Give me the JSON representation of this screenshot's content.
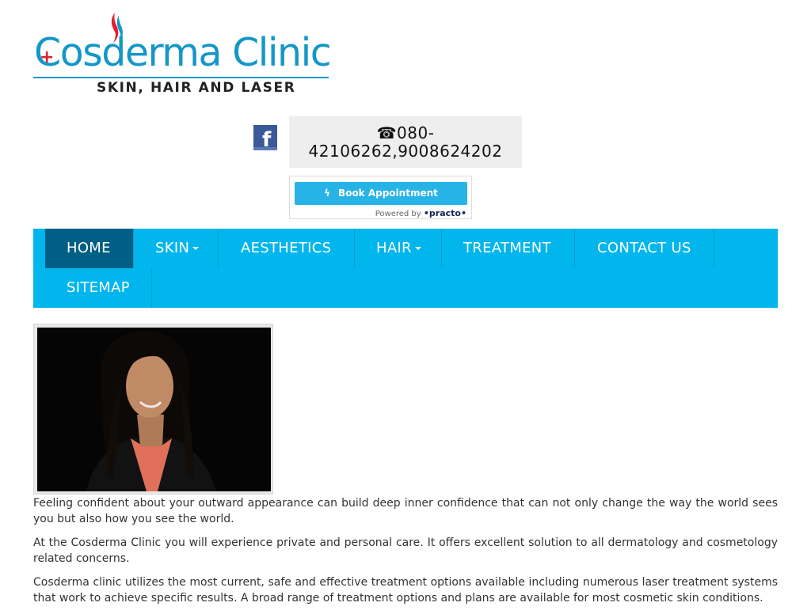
{
  "logo": {
    "title": "Cosderma Clinic",
    "cross": "+",
    "tagline": "SKIN, HAIR AND LASER",
    "brand_color": "#1497c8",
    "cross_color": "#e02030"
  },
  "social": {
    "facebook_glyph": "f",
    "icon": "facebook-icon",
    "color": "#3b5998"
  },
  "contact": {
    "phone_glyph": "☎",
    "phone_text": "080-42106262,9008624202"
  },
  "booking": {
    "button_label": "Book Appointment",
    "bolt_glyph": "ϟ",
    "powered_by": "Powered by",
    "brand": "•practo•",
    "color": "#28b3e6"
  },
  "nav": {
    "color": "#00b6ed",
    "active_color": "#005f85",
    "items": [
      {
        "label": "HOME",
        "active": true,
        "dropdown": false
      },
      {
        "label": "SKIN",
        "active": false,
        "dropdown": true
      },
      {
        "label": "AESTHETICS",
        "active": false,
        "dropdown": false
      },
      {
        "label": "HAIR",
        "active": false,
        "dropdown": true
      },
      {
        "label": "TREATMENT",
        "active": false,
        "dropdown": false
      },
      {
        "label": "CONTACT US",
        "active": false,
        "dropdown": false
      },
      {
        "label": "SITEMAP",
        "active": false,
        "dropdown": false
      }
    ]
  },
  "content": {
    "paragraphs": [
      "Feeling confident about your outward appearance can build deep inner confidence that can not only change the way the world sees you but also how you see the world.",
      "At the Cosderma Clinic you will experience private and personal care. It offers excellent solution to all dermatology and cosmetology related concerns.",
      "Cosderma clinic utilizes the most current, safe and effective treatment options available including numerous laser treatment systems that work to achieve specific results. A broad range of treatment options and plans are available for most cosmetic skin conditions."
    ]
  }
}
